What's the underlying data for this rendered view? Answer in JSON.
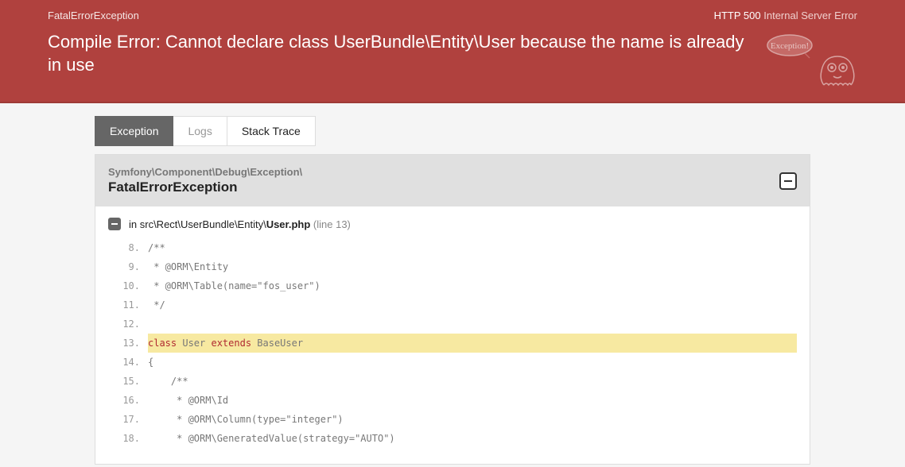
{
  "header": {
    "exception_type": "FatalErrorException",
    "http_code": "HTTP 500",
    "http_msg": "Internal Server Error",
    "title": "Compile Error: Cannot declare class UserBundle\\Entity\\User because the name is already in use",
    "ghost_bubble": "Exception!"
  },
  "tabs": [
    {
      "label": "Exception",
      "active": true
    },
    {
      "label": "Logs",
      "active": false,
      "dim": true
    },
    {
      "label": "Stack Trace",
      "active": false
    }
  ],
  "panel": {
    "namespace": "Symfony\\Component\\Debug\\Exception\\",
    "class": "FatalErrorException"
  },
  "trace": {
    "prefix": "in ",
    "path": "src\\Rect\\UserBundle\\Entity\\",
    "file": "User.php",
    "line_label": " (line 13)"
  },
  "code": [
    {
      "n": "8.",
      "t": "/**"
    },
    {
      "n": "9.",
      "t": " * @ORM\\Entity"
    },
    {
      "n": "10.",
      "t": " * @ORM\\Table(name=\"fos_user\")"
    },
    {
      "n": "11.",
      "t": " */"
    },
    {
      "n": "12.",
      "t": ""
    },
    {
      "n": "13.",
      "t_html": "<span class=\"kw\">class</span> User <span class=\"kw\">extends</span> BaseUser",
      "hl": true
    },
    {
      "n": "14.",
      "t": "{"
    },
    {
      "n": "15.",
      "t": "    /**"
    },
    {
      "n": "16.",
      "t": "     * @ORM\\Id"
    },
    {
      "n": "17.",
      "t": "     * @ORM\\Column(type=\"integer\")"
    },
    {
      "n": "18.",
      "t": "     * @ORM\\GeneratedValue(strategy=\"AUTO\")"
    }
  ]
}
